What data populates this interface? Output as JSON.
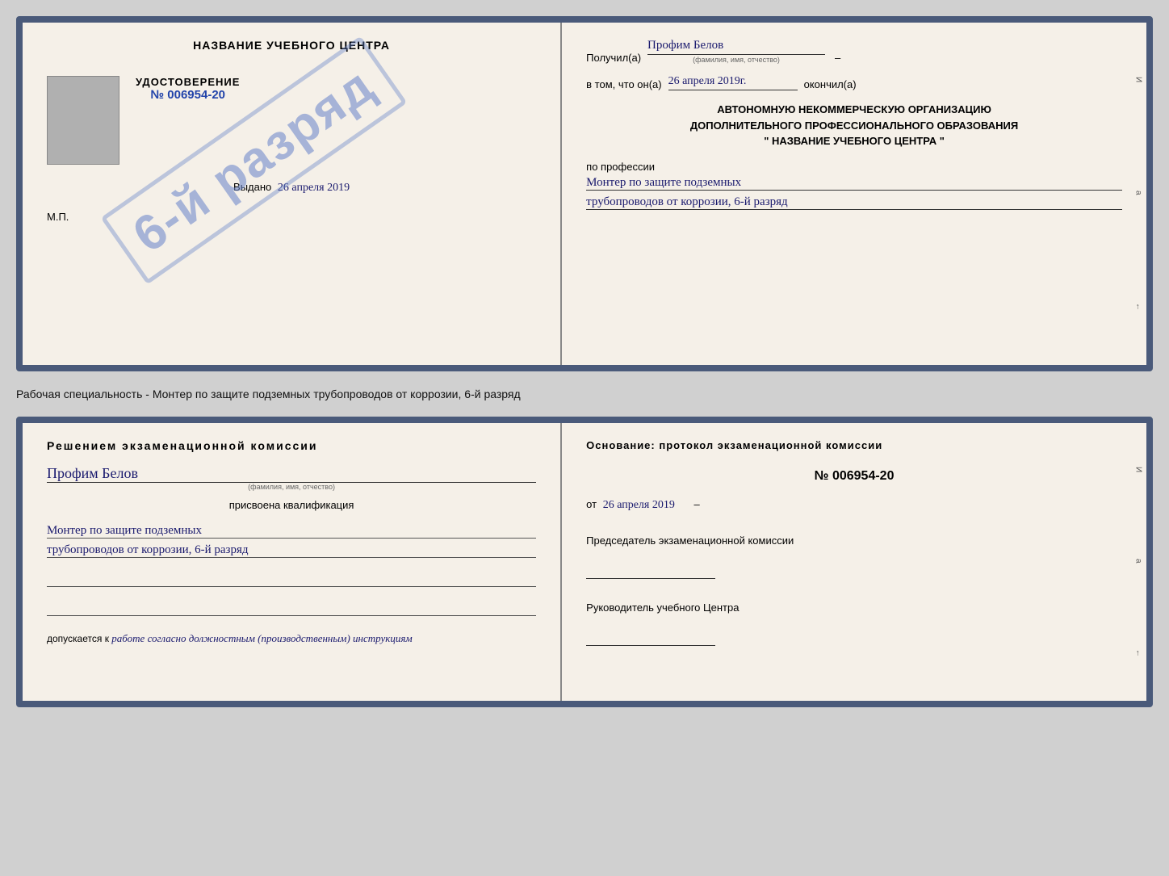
{
  "top_cert": {
    "left": {
      "title": "НАЗВАНИЕ УЧЕБНОГО ЦЕНТРА",
      "stamp_text": "6-й разряд",
      "udost_title": "УДОСТОВЕРЕНИЕ",
      "udost_number": "№ 006954-20",
      "vydano_label": "Выдано",
      "vydano_date": "26 апреля 2019",
      "mp_label": "М.П."
    },
    "right": {
      "poluchil_label": "Получил(а)",
      "poluchil_value": "Профим Белов",
      "poluchil_hint": "(фамилия, имя, отчество)",
      "vtom_label": "в том, что он(а)",
      "vtom_date": "26 апреля 2019г.",
      "okonchil_label": "окончил(а)",
      "org_line1": "АВТОНОМНУЮ НЕКОММЕРЧЕСКУЮ ОРГАНИЗАЦИЮ",
      "org_line2": "ДОПОЛНИТЕЛЬНОГО ПРОФЕССИОНАЛЬНОГО ОБРАЗОВАНИЯ",
      "org_line3": "\"   НАЗВАНИЕ УЧЕБНОГО ЦЕНТРА   \"",
      "profession_label": "по профессии",
      "profession_line1": "Монтер по защите подземных",
      "profession_line2": "трубопроводов от коррозии, 6-й разряд"
    }
  },
  "specialty_line": "Рабочая специальность - Монтер по защите подземных трубопроводов от коррозии, 6-й разряд",
  "bottom_cert": {
    "left": {
      "decision_title": "Решением  экзаменационной  комиссии",
      "name_value": "Профим Белов",
      "name_hint": "(фамилия, имя, отчество)",
      "prisvoena_label": "присвоена квалификация",
      "kvali_line1": "Монтер по защите подземных",
      "kvali_line2": "трубопроводов от коррозии, 6-й разряд",
      "dopusk_label": "допускается к",
      "dopusk_value": "работе согласно должностным (производственным) инструкциям"
    },
    "right": {
      "osnov_label": "Основание: протокол экзаменационной комиссии",
      "number_value": "№  006954-20",
      "ot_label": "от",
      "ot_date": "26 апреля 2019",
      "predsed_label": "Председатель экзаменационной комиссии",
      "rukov_label": "Руководитель учебного Центра"
    }
  },
  "side_chars": [
    "И",
    "а",
    "←"
  ]
}
